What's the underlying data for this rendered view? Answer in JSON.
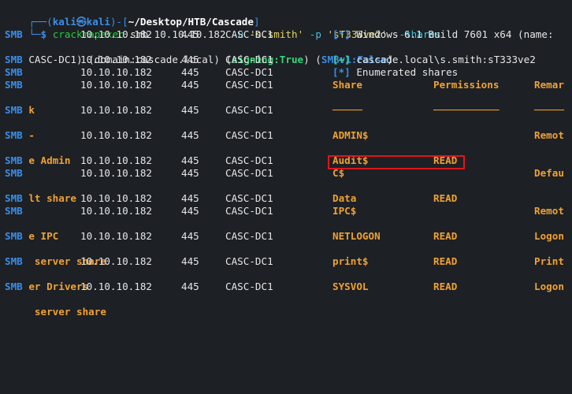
{
  "prompt": {
    "top_left": "┌──(",
    "user": "kali",
    "at": "㉿",
    "host": "kali",
    "mid": ")-[",
    "path": "~/Desktop/HTB/Cascade",
    "end": "]",
    "bottom_left": "└─",
    "dollar": "$"
  },
  "command": {
    "exe": "crackmapexec",
    "args1": " smb 10.10.10.182 ",
    "flag_u": "-u",
    "user": " 's.smith' ",
    "flag_p": "-p",
    "pass": " 'sT333ve2' ",
    "flag_shares": "--shares"
  },
  "output": {
    "proto": "SMB",
    "ip": "10.10.10.182",
    "port": "445",
    "host": "CASC-DC1",
    "rows": {
      "info": {
        "tag": "[*]",
        "text": " Windows 6.1 Build 7601 x64 (name:",
        "wrap_a": "CASC-DC1) (domain:cascade.local) (",
        "signing": "signing:True",
        "wrap_b": ") (",
        "smbv1": "SMBv1:False",
        "wrap_c": ")"
      },
      "auth": {
        "tag": "[+]",
        "text": " cascade.local\\s.smith:sT333ve2"
      },
      "enum": {
        "tag": "[*]",
        "text": " Enumerated shares"
      }
    },
    "header": {
      "share": "Share",
      "perm": "Permissions",
      "remark": "Remar",
      "remark_wrap": "k"
    },
    "dashes": {
      "share": "─────",
      "perm": "───────────",
      "remark": "─────",
      "remark_wrap": "-"
    },
    "shares": [
      {
        "name": "ADMIN$",
        "perm": "",
        "remark": "Remot",
        "wrap": "e Admin"
      },
      {
        "name": "Audit$",
        "perm": "READ",
        "remark": "",
        "wrap": ""
      },
      {
        "name": "C$",
        "perm": "",
        "remark": "Defau",
        "wrap": "lt share"
      },
      {
        "name": "Data",
        "perm": "READ",
        "remark": "",
        "wrap": ""
      },
      {
        "name": "IPC$",
        "perm": "",
        "remark": "Remot",
        "wrap": "e IPC"
      },
      {
        "name": "NETLOGON",
        "perm": "READ",
        "remark": "Logon",
        "wrap": " server share"
      },
      {
        "name": "print$",
        "perm": "READ",
        "remark": "Print",
        "wrap": "er Drivers"
      },
      {
        "name": "SYSVOL",
        "perm": "READ",
        "remark": "Logon",
        "wrap": " server share"
      }
    ]
  }
}
